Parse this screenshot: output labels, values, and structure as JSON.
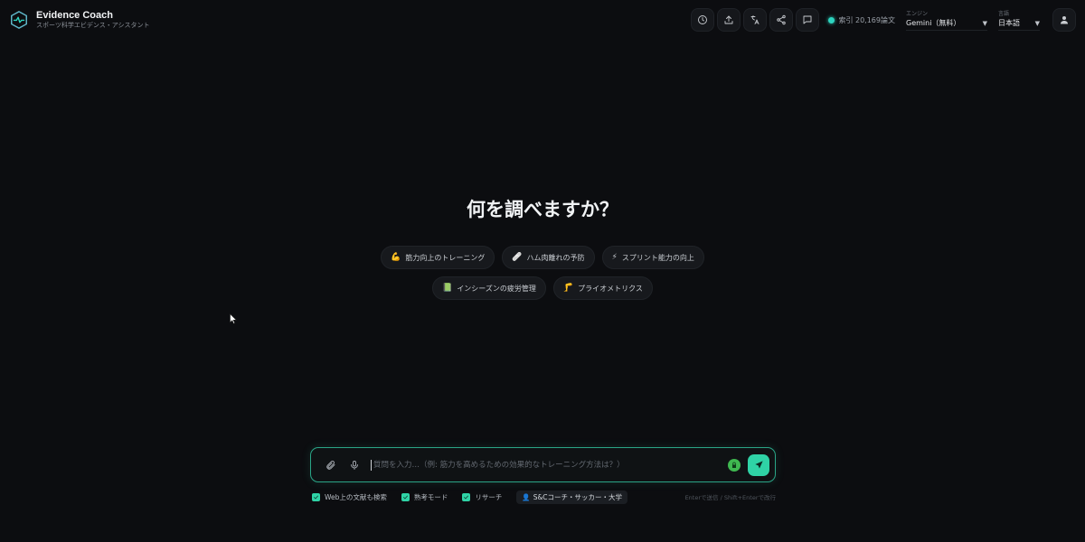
{
  "app": {
    "title": "Evidence Coach",
    "subtitle": "スポーツ科学エビデンス・アシスタント",
    "logo_icon": "hexagon-pulse-icon"
  },
  "toolbar": {
    "buttons": [
      {
        "icon": "history-icon"
      },
      {
        "icon": "upload-icon"
      },
      {
        "icon": "translate-icon"
      },
      {
        "icon": "share-icon"
      },
      {
        "icon": "chat-icon"
      }
    ],
    "index_status": "索引 20,169論文",
    "index_status_color": "#2dd4bf",
    "engine_label": "エンジン",
    "engine_value": "Gemini（無料）",
    "language_label": "言語",
    "language_value": "日本語",
    "user_icon": "user-icon"
  },
  "main": {
    "heading": "何を調べますか？",
    "suggestions_row1": [
      {
        "emoji": "💪",
        "label": "筋力向上のトレーニング"
      },
      {
        "emoji": "🩹",
        "label": "ハム肉離れの予防"
      },
      {
        "emoji": "⚡",
        "label": "スプリント能力の向上"
      }
    ],
    "suggestions_row2": [
      {
        "emoji": "📗",
        "label": "インシーズンの疲労管理"
      },
      {
        "emoji": "🦵",
        "label": "プライオメトリクス"
      }
    ]
  },
  "composer": {
    "placeholder": "質問を入力…（例: 筋力を高めるための効果的なトレーニング方法は？）",
    "value": "",
    "accent_color": "#2fd3a6",
    "options": [
      {
        "label": "Web上の文献も検索",
        "checked": true
      },
      {
        "label": "熟考モード",
        "checked": true
      },
      {
        "label": "リサーチ",
        "checked": true
      }
    ],
    "profile_emoji": "👤",
    "profile_label": "S&Cコーチ・サッカー・大学",
    "hint": "Enterで送信 / Shift+Enterで改行"
  }
}
